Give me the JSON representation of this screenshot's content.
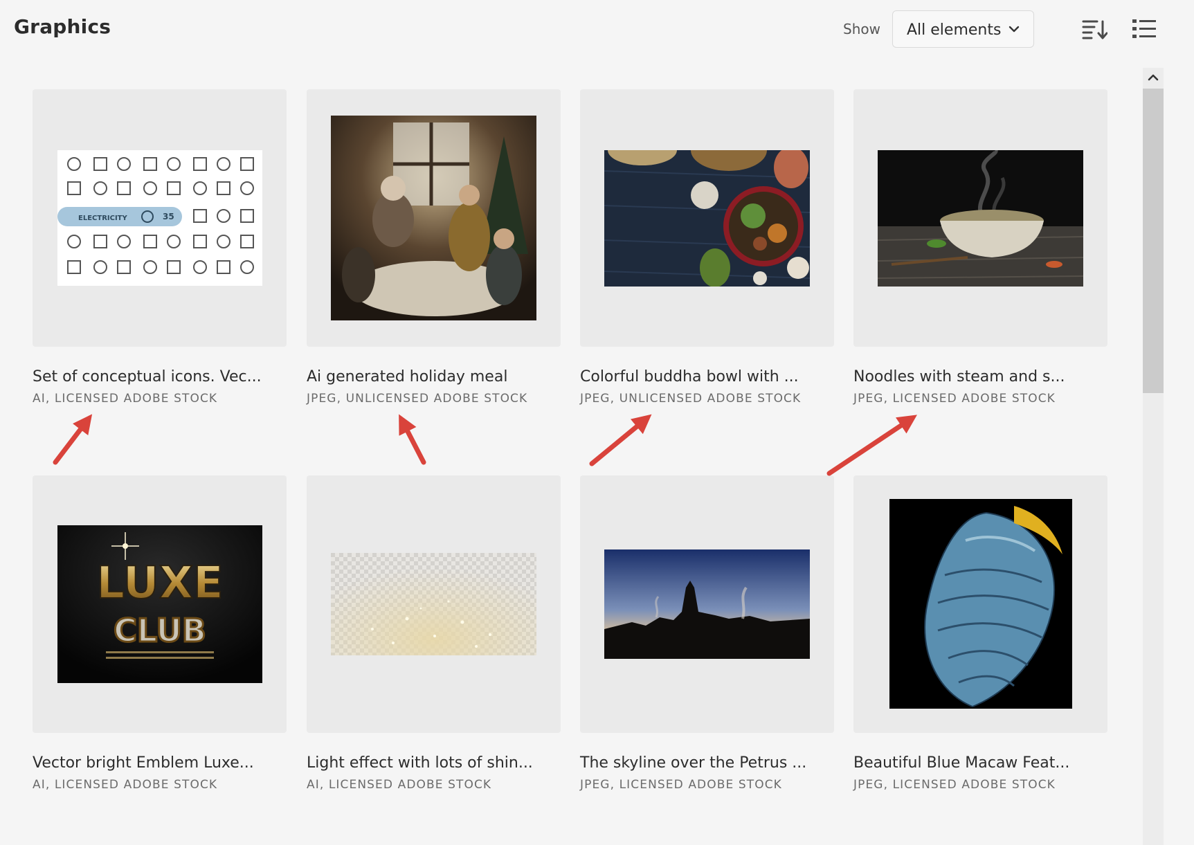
{
  "header": {
    "title": "Graphics",
    "show_label": "Show",
    "filter_value": "All elements"
  },
  "icons": {
    "filter": "chevron-down-icon",
    "sort": "sort-descending-icon",
    "view": "list-view-icon",
    "scroll": "chevron-up-icon"
  },
  "colors": {
    "background": "#f5f5f5",
    "card": "#eaeaea",
    "annotation_arrow": "#d9433b"
  },
  "assets": [
    {
      "title": "Set of conceptual icons. Vec...",
      "meta": "AI, LICENSED ADOBE STOCK",
      "thumb": "icon-set-electricity"
    },
    {
      "title": "Ai generated holiday meal",
      "meta": "JPEG, UNLICENSED ADOBE STOCK",
      "thumb": "holiday-meal-photo"
    },
    {
      "title": "Colorful buddha bowl with ...",
      "meta": "JPEG, UNLICENSED ADOBE STOCK",
      "thumb": "buddha-bowl-photo"
    },
    {
      "title": "Noodles with steam and s...",
      "meta": "JPEG, LICENSED ADOBE STOCK",
      "thumb": "noodles-photo"
    },
    {
      "title": "Vector bright Emblem Luxe...",
      "meta": "AI, LICENSED ADOBE STOCK",
      "thumb": "luxe-club-emblem"
    },
    {
      "title": "Light effect with lots of shin...",
      "meta": "AI, LICENSED ADOBE STOCK",
      "thumb": "light-sparkle-effect"
    },
    {
      "title": "The skyline over the Petrus ...",
      "meta": "JPEG, LICENSED ADOBE STOCK",
      "thumb": "city-skyline-photo"
    },
    {
      "title": "Beautiful Blue Macaw Feat...",
      "meta": "JPEG, LICENSED ADOBE STOCK",
      "thumb": "macaw-feathers-photo"
    }
  ],
  "thumb_text": {
    "icon_set_banner": "ELECTRICITY",
    "icon_set_number": "35",
    "luxe_top": "LUXE",
    "luxe_bottom": "CLUB"
  }
}
